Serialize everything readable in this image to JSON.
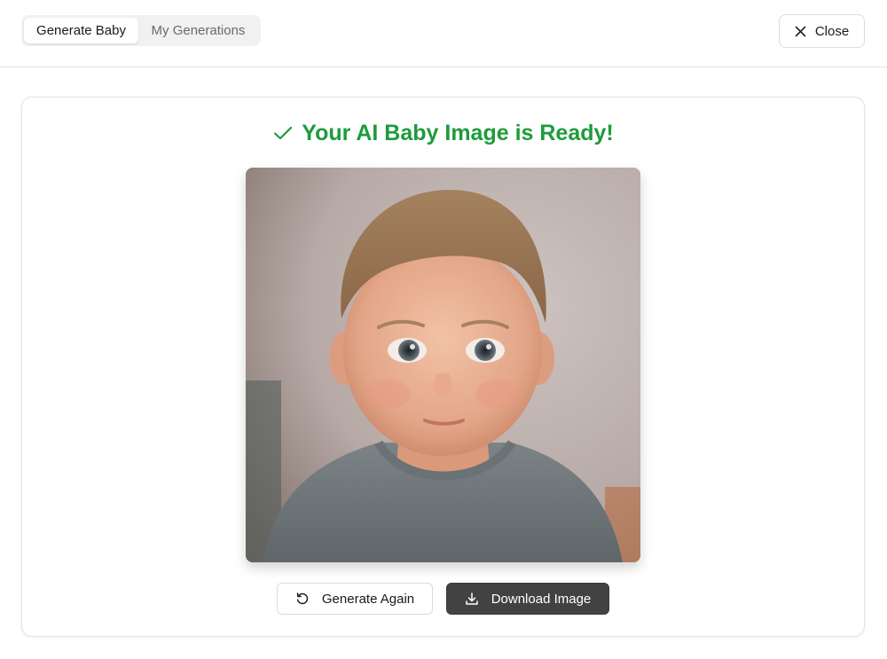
{
  "tabs": [
    {
      "label": "Generate Baby",
      "active": true
    },
    {
      "label": "My Generations",
      "active": false
    }
  ],
  "close_label": "Close",
  "result": {
    "title": "Your AI Baby Image is Ready!",
    "title_color": "#1e9b3c",
    "image_alt": "Generated baby portrait"
  },
  "actions": {
    "generate_again_label": "Generate Again",
    "download_label": "Download Image",
    "download_bg": "#424242"
  },
  "icons": {
    "close": "x-icon",
    "check": "checkmark-icon",
    "refresh": "refresh-icon",
    "download": "download-icon"
  }
}
